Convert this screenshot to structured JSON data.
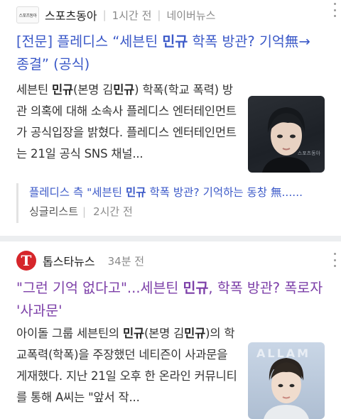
{
  "articles": [
    {
      "source": "스포츠동아",
      "logo_text": "스포츠동아",
      "time": "1시간 전",
      "platform": "네이버뉴스",
      "headline_pre": "[전문] 플레디스 “세븐틴 ",
      "headline_bold": "민규",
      "headline_post": " 학폭 방관? 기억無→종결” (공식)",
      "summary_parts": [
        "세븐틴 ",
        "민규",
        "(본명 김",
        "민규",
        ") 학폭(학교 폭력) 방관 의혹에 대해 소속사 플레디스 엔터테인먼트가 공식입장을 밝혔다. 플레디스 엔터테인먼트는 21일 공식 SNS 채널..."
      ],
      "thumb_watermark": "스포츠동아",
      "related": {
        "title_pre": "플레디스 측 \"세븐틴 ",
        "title_bold": "민규",
        "title_post": " 학폭 방관? 기억하는 동창 無......",
        "source": "싱글리스트",
        "time": "2시간 전"
      }
    },
    {
      "source": "톱스타뉴스",
      "logo_text": "T",
      "time": "34분 전",
      "headline_pre": "\"그런 기억 없다고\"...세븐틴 ",
      "headline_bold": "민규",
      "headline_post": ", 학폭 방관? 폭로자 '사과문'",
      "summary_parts": [
        "아이돌 그룹 세븐틴의 ",
        "민규",
        "(본명 김",
        "민규",
        ")의 학교폭력(학폭)을 주장했던 네티즌이 사과문을 게재했다. 지난 21일 오후 한 온라인 커뮤니티를 통해 A씨는 \"앞서 작..."
      ],
      "thumb_banner": "ALLAM"
    }
  ],
  "colors": {
    "link": "#3b59c8",
    "visited": "#7c3fa8",
    "logo_red": "#d6262b"
  }
}
